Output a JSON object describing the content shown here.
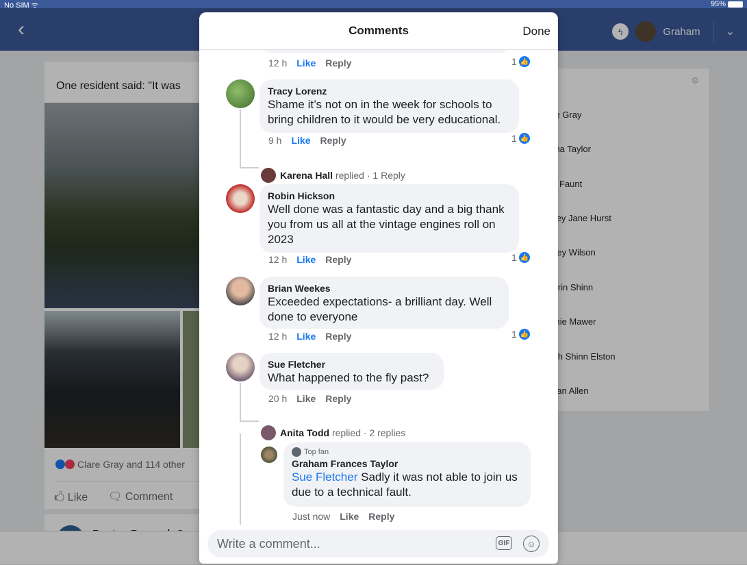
{
  "status_bar": {
    "carrier": "No SIM ᯤ",
    "battery": "95%"
  },
  "nav": {
    "user_name": "Graham"
  },
  "background_post": {
    "text": "One resident said: \"It was",
    "reactions": "Clare Gray and 114 other",
    "like_label": "Like",
    "comment_label": "Comment",
    "next_post_name": "Boston Borough C"
  },
  "contacts": [
    "lare Gray",
    "mma Taylor",
    "my Faunt",
    "esley Jane Hurst",
    "hirley Wilson",
    "herrin Shinn",
    "ophie Mawer",
    "arah Shinn Elston",
    "legan Allen"
  ],
  "modal": {
    "title": "Comments",
    "done_label": "Done"
  },
  "comments": [
    {
      "time": "12 h",
      "like": "Like",
      "reply": "Reply",
      "count": "1"
    },
    {
      "name": "Tracy Lorenz",
      "text_lines": [
        "Shame it’s not on in the week for schools to",
        "bring children to it would be very educational."
      ],
      "time": "9 h",
      "like": "Like",
      "reply": "Reply",
      "count": "1"
    },
    {
      "name": "Robin Hickson",
      "text_lines": [
        "Well done was a fantastic day and a big thank",
        "you from us all at the vintage engines roll on",
        "2023"
      ],
      "time": "12 h",
      "like": "Like",
      "reply": "Reply",
      "count": "1"
    },
    {
      "name": "Brian Weekes",
      "text_lines": [
        "Exceeded expectations- a brilliant day. Well",
        "done to everyone"
      ],
      "time": "12 h",
      "like": "Like",
      "reply": "Reply",
      "count": "1"
    },
    {
      "name": "Sue Fletcher",
      "text_lines": [
        "What happened to the fly past?"
      ],
      "time": "20 h",
      "like": "Like",
      "reply": "Reply"
    }
  ],
  "replies_summary": [
    {
      "name": "Karena Hall",
      "action": "replied",
      "count": "· 1 Reply"
    },
    {
      "name": "Anita Todd",
      "action": "replied",
      "count": "· 2 replies"
    }
  ],
  "nested_reply": {
    "badge": "Top fan",
    "name": "Graham Frances Taylor",
    "mention": "Sue Fletcher",
    "text_rest": "Sadly it was not able to join us",
    "text_line2": "due to a technical fault.",
    "time": "Just now",
    "like": "Like",
    "reply": "Reply"
  },
  "composer": {
    "placeholder": "Write a comment...",
    "gif_label": "GIF",
    "emoji_glyph": "☺"
  },
  "icons": {
    "back": "‹",
    "chevron": "⌄",
    "messenger": "ϟ",
    "gear": "⚙",
    "thumb": "👍"
  }
}
